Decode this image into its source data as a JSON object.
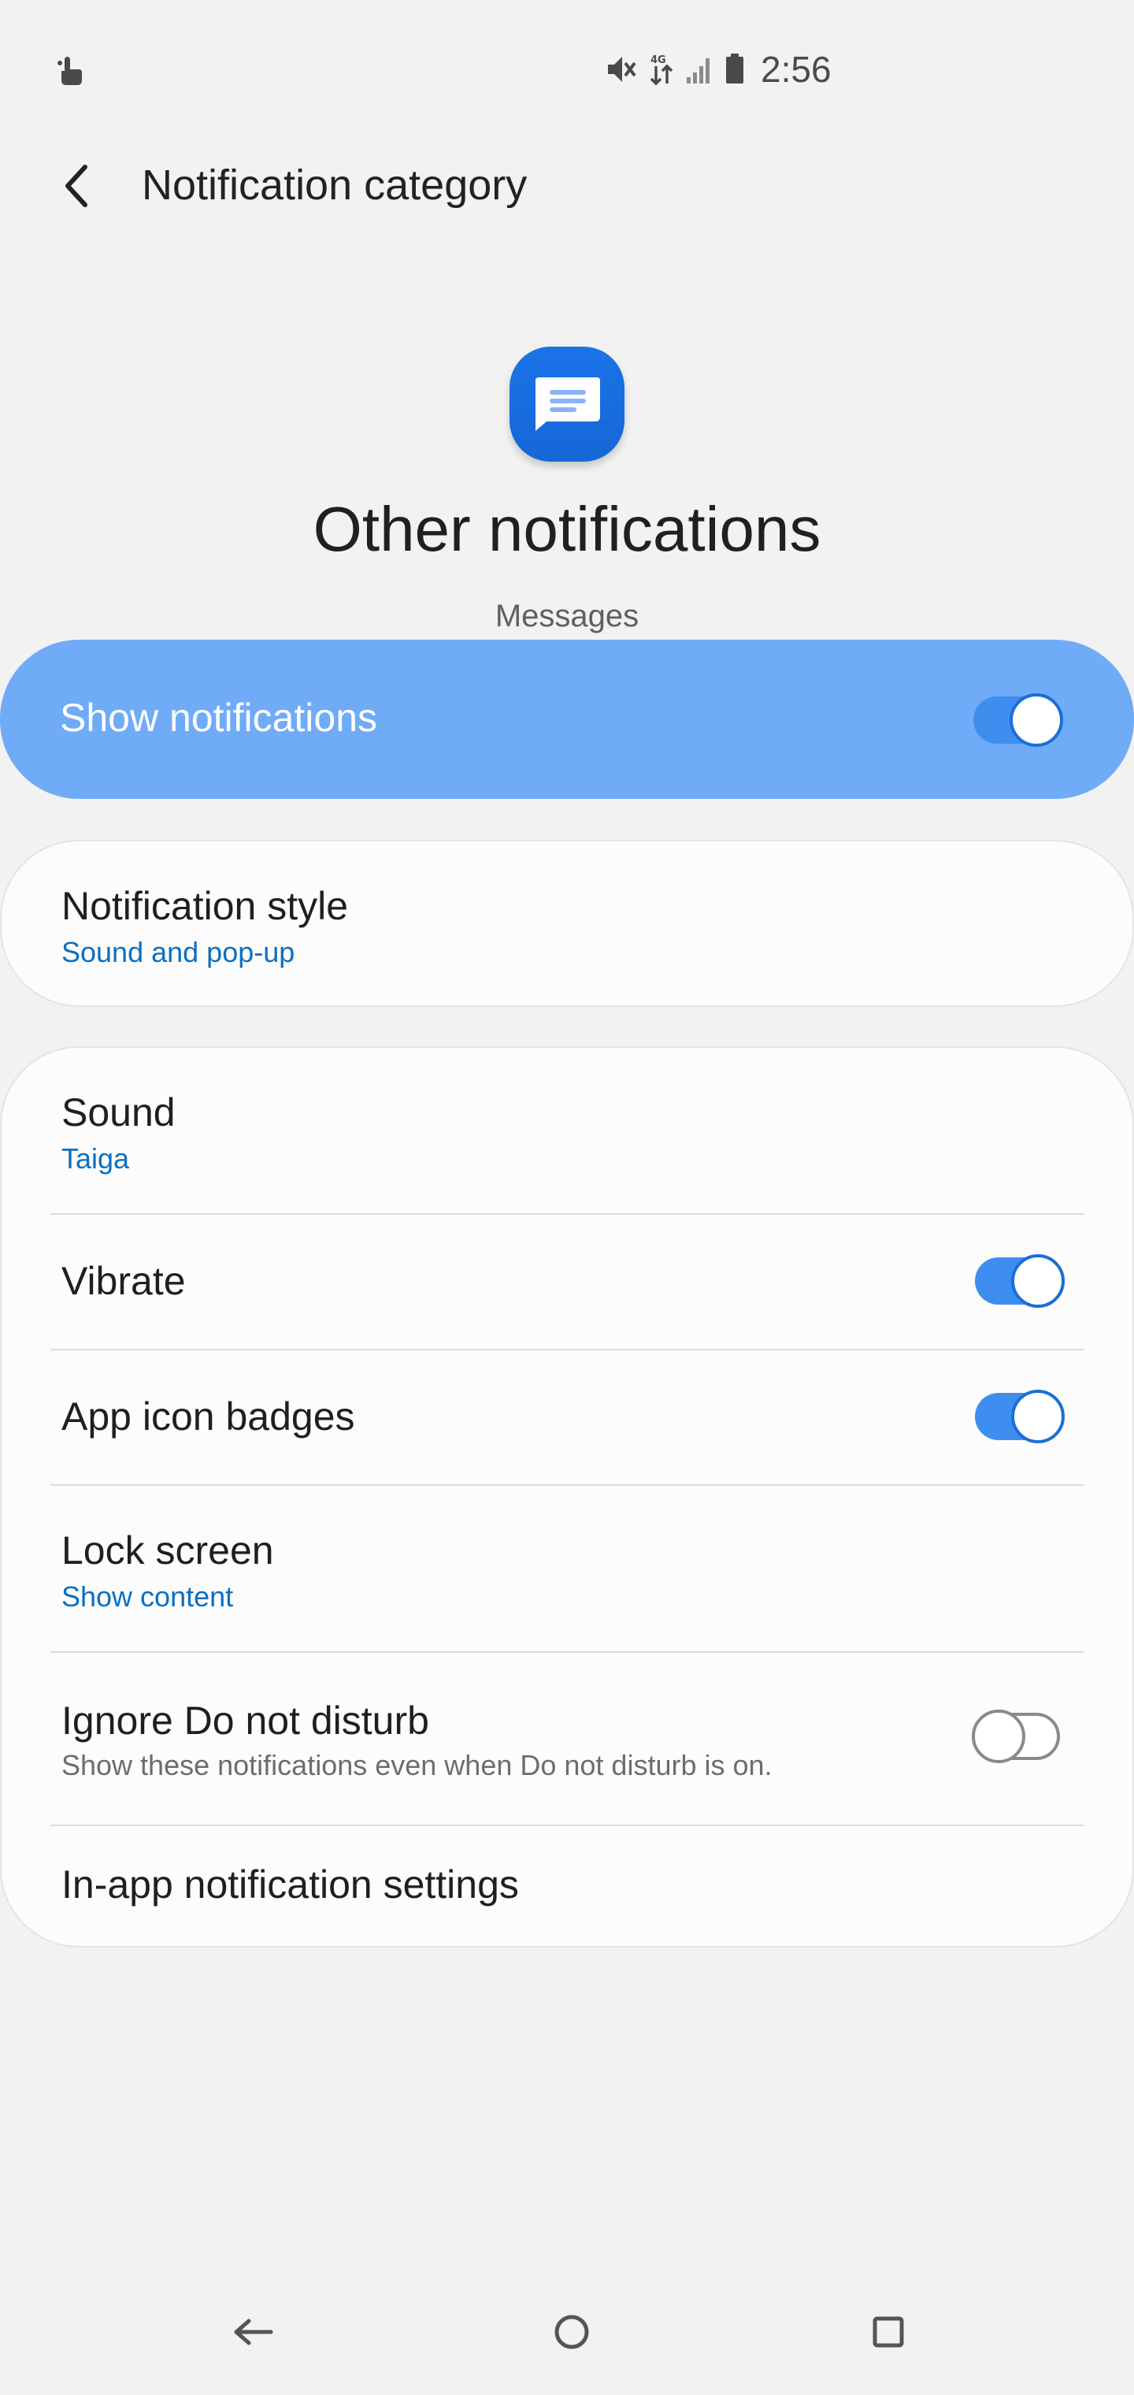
{
  "status_bar": {
    "time": "2:56"
  },
  "app_bar": {
    "title": "Notification category"
  },
  "header": {
    "title": "Other notifications",
    "subtitle": "Messages"
  },
  "master": {
    "label": "Show notifications",
    "enabled": true
  },
  "style_card": {
    "title": "Notification style",
    "value": "Sound and pop-up"
  },
  "settings": {
    "sound": {
      "title": "Sound",
      "value": "Taiga"
    },
    "vibrate": {
      "title": "Vibrate",
      "enabled": true
    },
    "badges": {
      "title": "App icon badges",
      "enabled": true
    },
    "lock_screen": {
      "title": "Lock screen",
      "value": "Show content"
    },
    "dnd": {
      "title": "Ignore Do not disturb",
      "description": "Show these notifications even when Do not disturb is on.",
      "enabled": false
    },
    "in_app": {
      "title": "In-app notification settings"
    }
  },
  "colors": {
    "accent": "#3e8ef0",
    "master_background": "#70abf8",
    "link": "#0b6fc2",
    "app_icon": "#1a73e8"
  },
  "icons": {
    "status_left": "touch-hand-icon",
    "status_right": [
      "mute-vibrate-icon",
      "data-transfer-icon",
      "signal-icon",
      "battery-icon"
    ],
    "app": "messages-app-icon",
    "nav": [
      "nav-back-icon",
      "nav-home-icon",
      "nav-recents-icon"
    ]
  }
}
